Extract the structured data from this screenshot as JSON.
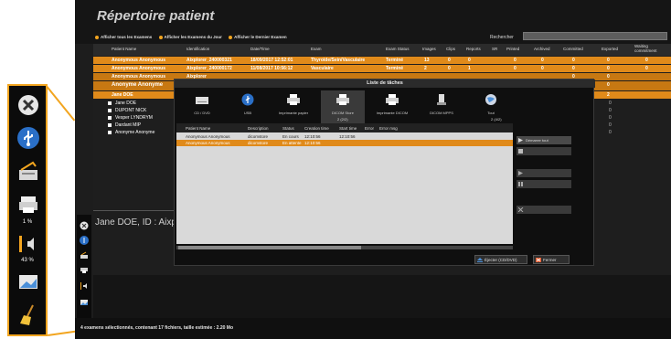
{
  "window": {
    "title": "Répertoire patient"
  },
  "filters": [
    {
      "label": "Afficher tous les Examens"
    },
    {
      "label": "Afficher les Examens du Jour"
    },
    {
      "label": "Afficher le Dernier Examen"
    }
  ],
  "search": {
    "label": "Rechercher",
    "value": ""
  },
  "table": {
    "columns": [
      "Patient Name",
      "Identification",
      "Date/Time",
      "Exam",
      "Exam Status",
      "Images",
      "Clips",
      "Reports",
      "SR",
      "Printed",
      "Archived",
      "Committed",
      "Exported",
      "Waiting commitment"
    ],
    "rows": [
      {
        "name": "Anonymous Anonymous",
        "id": "Aixplorer_240000321",
        "date": "18/09/2017 12:52:01",
        "exam": "Thyroïde/Sein/Vasculaire",
        "status": "Terminé",
        "images": "13",
        "clips": "0",
        "reports": "0",
        "sr": "",
        "printed": "0",
        "archived": "0",
        "committed": "0",
        "exported": "0",
        "waiting": "0"
      },
      {
        "name": "Anonymous Anonymous",
        "id": "Aixplorer_240000172",
        "date": "11/08/2017 10:56:12",
        "exam": "Vasculaire",
        "status": "Terminé",
        "images": "2",
        "clips": "0",
        "reports": "1",
        "sr": "",
        "printed": "0",
        "archived": "0",
        "committed": "0",
        "exported": "0",
        "waiting": "0"
      },
      {
        "name": "Anonymous Anonymous",
        "id": "Aixplorer",
        "date": "",
        "exam": "",
        "status": "",
        "images": "",
        "clips": "",
        "reports": "",
        "sr": "",
        "printed": "",
        "archived": "",
        "committed": "0",
        "exported": "0",
        "waiting": ""
      },
      {
        "name": "Anonyme Anonyme",
        "id": "",
        "date": "",
        "exam": "",
        "status": "",
        "images": "",
        "clips": "",
        "reports": "",
        "sr": "",
        "printed": "",
        "archived": "",
        "committed": "0",
        "exported": "0",
        "waiting": ""
      },
      {
        "name": "Jane DOE",
        "id": "",
        "date": "",
        "exam": "",
        "status": "",
        "images": "",
        "clips": "",
        "reports": "",
        "sr": "",
        "printed": "",
        "archived": "",
        "committed": "0",
        "exported": "2",
        "waiting": ""
      }
    ],
    "plain_rows": [
      {
        "name": "Jane DOE",
        "committed": "0",
        "exported": "0"
      },
      {
        "name": "DUPONT NICK",
        "committed": "0",
        "exported": "0"
      },
      {
        "name": "Vesper LYNDRYM",
        "committed": "0",
        "exported": "0"
      },
      {
        "name": "Dardant MIP",
        "committed": "0",
        "exported": "0"
      },
      {
        "name": "Anonyme Anonyme",
        "committed": "0",
        "exported": "0"
      }
    ]
  },
  "patient_info": "Jane DOE, ID : Aixplor",
  "status_bar": "4 examens sélectionnés, contenant 17 fichiers, taille estimée : 2.20 Mo",
  "dialog": {
    "title": "Liste de tâches",
    "destinations": [
      {
        "label": "CD / DVD",
        "icon": "cd-icon"
      },
      {
        "label": "USB",
        "icon": "usb-icon"
      },
      {
        "label": "Imprimante papier",
        "icon": "paper-printer-icon"
      },
      {
        "label": "DICOM Store",
        "icon": "dicom-store-icon",
        "count": "2 (2/2)"
      },
      {
        "label": "Imprimante DICOM",
        "icon": "dicom-printer-icon"
      },
      {
        "label": "DICOM MPPS",
        "icon": "dicom-mpps-icon"
      },
      {
        "label": "Tout",
        "icon": "globe-icon",
        "count": "2 (4/2)"
      }
    ],
    "task_columns": [
      "Patient Name",
      "Description",
      "Status",
      "Creation time",
      "Start time",
      "Error",
      "Error msg"
    ],
    "tasks": [
      {
        "patient": "Anonymous Anonymous",
        "description": "dicomstore",
        "status": "En cours",
        "creation": "12:10:56",
        "start": "12:10:56",
        "error": "",
        "error_msg": ""
      },
      {
        "patient": "Anonymous Anonymous",
        "description": "dicomstore",
        "status": "En attente",
        "creation": "12:10:56",
        "start": "",
        "error": "",
        "error_msg": ""
      }
    ],
    "side_buttons": [
      {
        "label": "Démarrer tout",
        "icon": "play-all-icon"
      },
      {
        "label": "",
        "icon": "stop-all-icon"
      },
      {
        "label": "",
        "icon": "play-icon"
      },
      {
        "label": "",
        "icon": "pause-icon"
      },
      {
        "label": "",
        "icon": "delete-icon"
      }
    ],
    "footer": {
      "eject_label": "Éjecter (CD/DVD)",
      "close_label": "Fermer"
    }
  },
  "callout": {
    "print_pct": "1 %",
    "volume_pct": "43 %"
  },
  "colors": {
    "accent": "#f2a51f",
    "row_highlight": "#e08a1a",
    "background": "#151515"
  }
}
